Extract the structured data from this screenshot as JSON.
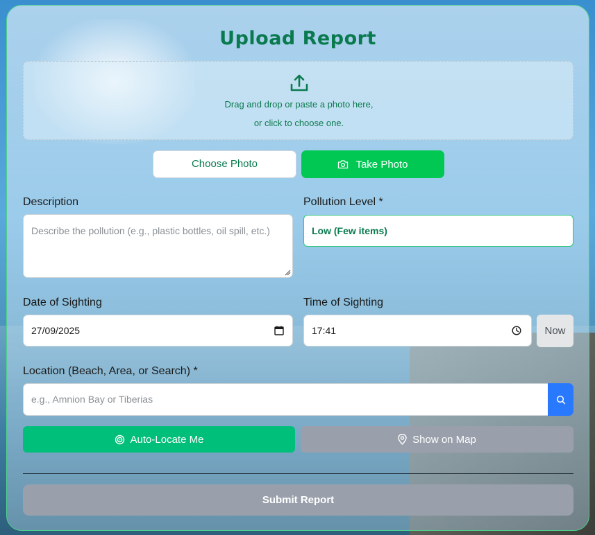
{
  "title": "Upload Report",
  "dropzone": {
    "icon": "upload-icon",
    "line1": "Drag and drop or paste a photo here,",
    "line2": "or click to choose one."
  },
  "photo_buttons": {
    "choose_label": "Choose Photo",
    "take_label": "Take Photo",
    "take_icon": "camera-icon"
  },
  "description": {
    "label": "Description",
    "placeholder": "Describe the pollution (e.g., plastic bottles, oil spill, etc.)",
    "value": ""
  },
  "pollution_level": {
    "label": "Pollution Level *",
    "selected": "Low (Few items)"
  },
  "date": {
    "label": "Date of Sighting",
    "value": "27/09/2025",
    "icon": "calendar-icon"
  },
  "time": {
    "label": "Time of Sighting",
    "value": "17:41",
    "icon": "clock-icon",
    "now_label": "Now"
  },
  "location": {
    "label": "Location (Beach, Area, or Search) *",
    "placeholder": "e.g., Amnion Bay or Tiberias",
    "value": "",
    "search_icon": "search-icon"
  },
  "location_buttons": {
    "auto_label": "Auto-Locate Me",
    "auto_icon": "target-icon",
    "map_label": "Show on Map",
    "map_icon": "map-pin-icon"
  },
  "submit_label": "Submit Report",
  "colors": {
    "accent_green": "#00c853",
    "title_green": "#0a7a4e",
    "search_blue": "#2979ff",
    "disabled_gray": "#9aa0ab"
  }
}
